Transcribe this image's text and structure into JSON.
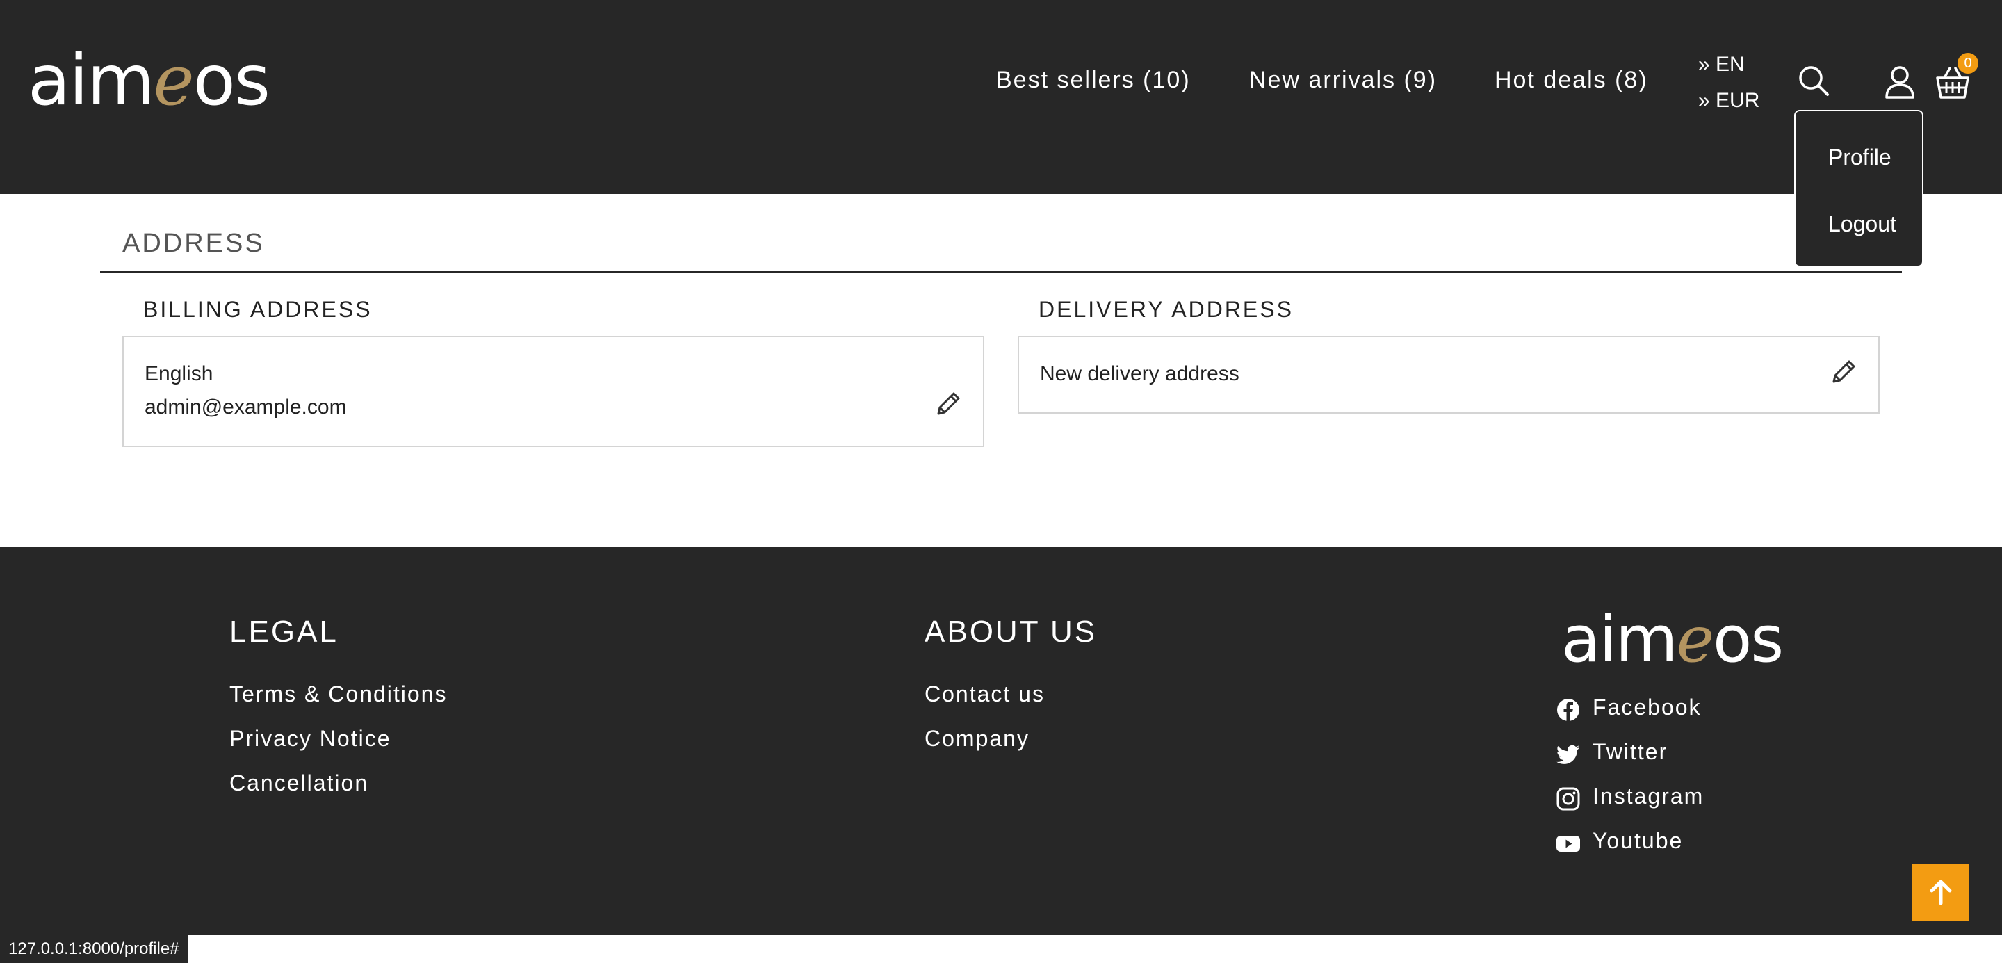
{
  "header": {
    "logo": {
      "pre": "aim",
      "accent": "e",
      "post": "os"
    },
    "nav": [
      {
        "label": "Best sellers (10)"
      },
      {
        "label": "New arrivals (9)"
      },
      {
        "label": "Hot deals (8)"
      }
    ],
    "locale": {
      "language": "» EN",
      "currency": "» EUR"
    },
    "icons": {
      "search": "search-icon",
      "account": "user-icon",
      "basket": "basket-icon"
    },
    "basket_count": "0",
    "account_menu": [
      {
        "label": "Profile"
      },
      {
        "label": "Logout"
      }
    ]
  },
  "main": {
    "title": "ADDRESS",
    "billing": {
      "title": "BILLING ADDRESS",
      "lines": [
        "English",
        "admin@example.com"
      ],
      "edit_icon": "pencil-icon"
    },
    "delivery": {
      "title": "DELIVERY ADDRESS",
      "lines": [
        "New delivery address"
      ],
      "edit_icon": "pencil-icon"
    }
  },
  "footer": {
    "legal": {
      "title": "LEGAL",
      "links": [
        "Terms & Conditions",
        "Privacy Notice",
        "Cancellation"
      ]
    },
    "about": {
      "title": "ABOUT US",
      "links": [
        "Contact us",
        "Company"
      ]
    },
    "logo": {
      "pre": "aim",
      "accent": "e",
      "post": "os"
    },
    "social": [
      {
        "label": "Facebook",
        "icon": "facebook-icon"
      },
      {
        "label": "Twitter",
        "icon": "twitter-icon"
      },
      {
        "label": "Instagram",
        "icon": "instagram-icon"
      },
      {
        "label": "Youtube",
        "icon": "youtube-icon"
      }
    ],
    "back_to_top_icon": "arrow-up-icon"
  },
  "statusbar": {
    "url": "127.0.0.1:8000/profile#"
  },
  "colors": {
    "dark": "#272727",
    "accent_gold": "#b49560",
    "accent_orange": "#f39c12",
    "border": "#d4d4d4"
  }
}
